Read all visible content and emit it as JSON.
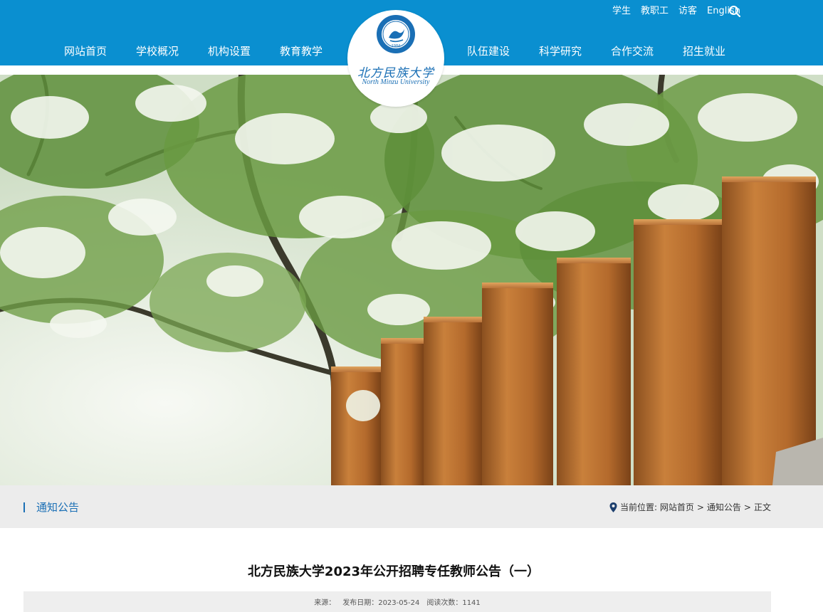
{
  "header": {
    "top_links": [
      "学生",
      "教职工",
      "访客",
      "English"
    ],
    "nav_left": [
      "网站首页",
      "学校概况",
      "机构设置",
      "教育教学"
    ],
    "nav_right": [
      "队伍建设",
      "科学研究",
      "合作交流",
      "招生就业"
    ],
    "logo_cn": "北方民族大学",
    "logo_en": "North Minzu University",
    "logo_year": "1984",
    "brand_color": "#0a8fd0"
  },
  "section": {
    "title": "通知公告",
    "breadcrumb_label": "当前位置:",
    "breadcrumb": [
      "网站首页",
      "通知公告",
      "正文"
    ],
    "separator": ">"
  },
  "article": {
    "title": "北方民族大学2023年公开招聘专任教师公告（一）",
    "source_label": "来源：",
    "date_label": "发布日期：",
    "date": "2023-05-24",
    "views_label": "阅读次数：",
    "views": "1141"
  },
  "icons": [
    "search-icon",
    "location-pin-icon"
  ]
}
